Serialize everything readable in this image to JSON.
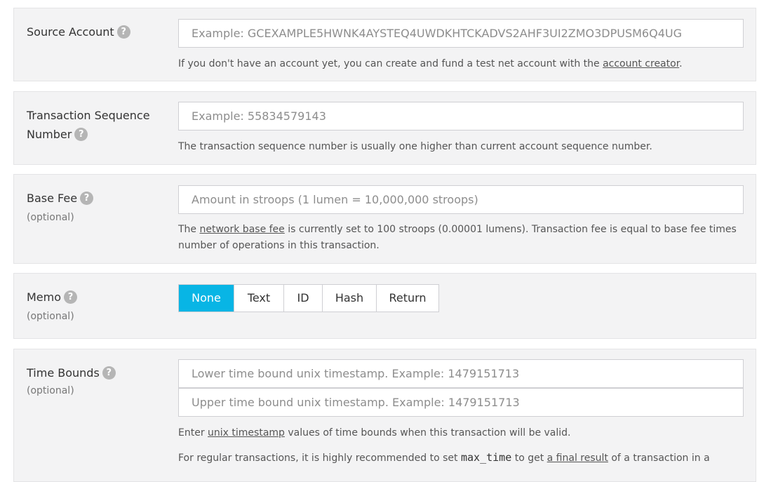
{
  "source_account": {
    "label": "Source Account",
    "placeholder": "Example: GCEXAMPLE5HWNK4AYSTEQ4UWDKHTCKADVS2AHF3UI2ZMO3DPUSM6Q4UG",
    "note_prefix": "If you don't have an account yet, you can create and fund a test net account with the ",
    "note_link": "account creator",
    "note_suffix": "."
  },
  "sequence": {
    "label": "Transaction Sequence Number",
    "placeholder": "Example: 55834579143",
    "note": "The transaction sequence number is usually one higher than current account sequence number."
  },
  "base_fee": {
    "label": "Base Fee",
    "optional": "(optional)",
    "placeholder": "Amount in stroops (1 lumen = 10,000,000 stroops)",
    "note_prefix": "The ",
    "note_link": "network base fee",
    "note_suffix": " is currently set to 100 stroops (0.00001 lumens). Transaction fee is equal to base fee times number of operations in this transaction."
  },
  "memo": {
    "label": "Memo",
    "optional": "(optional)",
    "options": [
      "None",
      "Text",
      "ID",
      "Hash",
      "Return"
    ],
    "selected": "None"
  },
  "time_bounds": {
    "label": "Time Bounds",
    "optional": "(optional)",
    "lower_placeholder": "Lower time bound unix timestamp. Example: 1479151713",
    "upper_placeholder": "Upper time bound unix timestamp.  Example: 1479151713",
    "note1_prefix": "Enter ",
    "note1_link": "unix timestamp",
    "note1_suffix": " values of time bounds when this transaction will be valid.",
    "note2_prefix": "For regular transactions, it is highly recommended to set ",
    "note2_code": "max_time",
    "note2_mid": " to get ",
    "note2_link": "a final result",
    "note2_suffix": " of a transaction in a"
  },
  "help_glyph": "?",
  "colors": {
    "accent": "#08b5e5",
    "row_bg": "#f3f3f4"
  }
}
